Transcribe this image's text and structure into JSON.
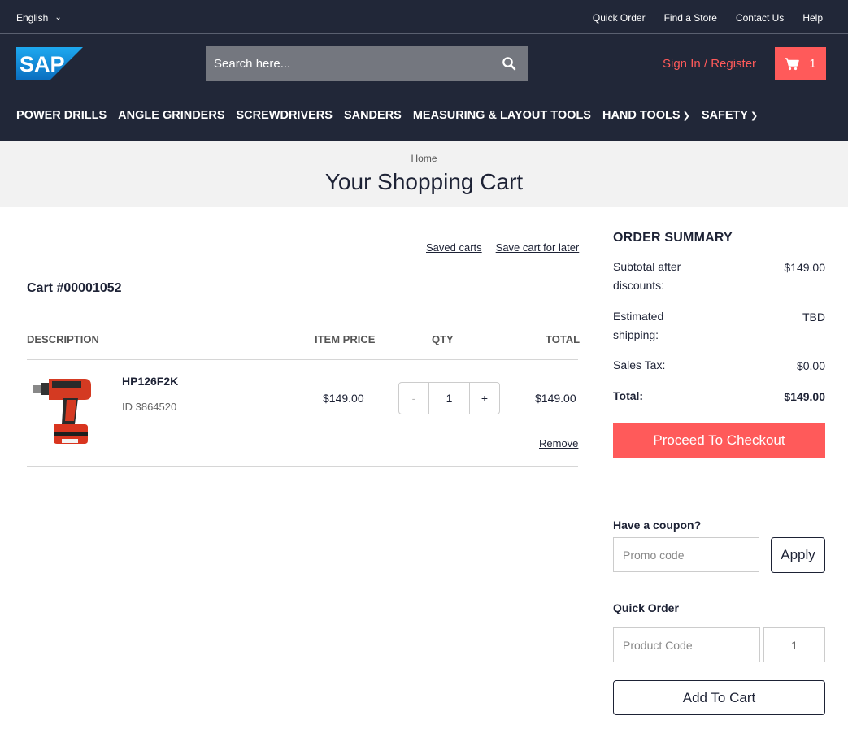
{
  "topbar": {
    "language": "English",
    "links": [
      "Quick Order",
      "Find a Store",
      "Contact Us",
      "Help"
    ]
  },
  "header": {
    "logo_text": "SAP",
    "search_placeholder": "Search here...",
    "sign_in": "Sign In / Register",
    "cart_count": "1",
    "nav": [
      {
        "label": "POWER DRILLS",
        "has_dropdown": false
      },
      {
        "label": "ANGLE GRINDERS",
        "has_dropdown": false
      },
      {
        "label": "SCREWDRIVERS",
        "has_dropdown": false
      },
      {
        "label": "SANDERS",
        "has_dropdown": false
      },
      {
        "label": "MEASURING & LAYOUT TOOLS",
        "has_dropdown": false
      },
      {
        "label": "HAND TOOLS",
        "has_dropdown": true
      },
      {
        "label": "SAFETY",
        "has_dropdown": true
      }
    ]
  },
  "page": {
    "breadcrumb": "Home",
    "title": "Your Shopping Cart"
  },
  "cart": {
    "saved_carts": "Saved carts",
    "save_for_later": "Save cart for later",
    "cart_id": "Cart #00001052",
    "columns": {
      "description": "DESCRIPTION",
      "item_price": "ITEM PRICE",
      "qty": "QTY",
      "total": "TOTAL"
    },
    "items": [
      {
        "name": "HP126F2K",
        "id": "ID 3864520",
        "price": "$149.00",
        "qty": "1",
        "minus": "-",
        "plus": "+",
        "total": "$149.00",
        "remove": "Remove",
        "image": "drill-icon"
      }
    ]
  },
  "summary": {
    "title": "ORDER SUMMARY",
    "subtotal_label": "Subtotal after discounts:",
    "subtotal": "$149.00",
    "shipping_label": "Estimated shipping:",
    "shipping": "TBD",
    "tax_label": "Sales Tax:",
    "tax": "$0.00",
    "total_label": "Total:",
    "total": "$149.00",
    "checkout": "Proceed To Checkout"
  },
  "coupon": {
    "title": "Have a coupon?",
    "placeholder": "Promo code",
    "apply": "Apply"
  },
  "quick_order": {
    "title": "Quick Order",
    "placeholder": "Product Code",
    "qty": "1",
    "add": "Add To Cart"
  },
  "colors": {
    "header_bg": "#212738",
    "accent": "#ff5a5a",
    "band_bg": "#f2f2f2"
  }
}
